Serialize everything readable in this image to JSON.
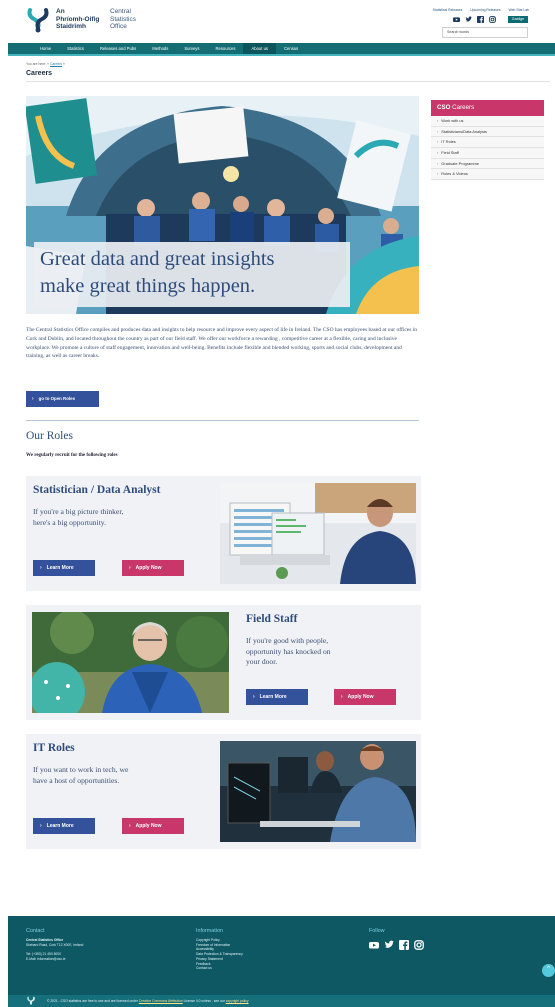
{
  "header": {
    "brand_irish": [
      "An",
      "Phríomh-Oifig",
      "Staidrimh"
    ],
    "brand_english": [
      "Central",
      "Statistics",
      "Office"
    ],
    "top_links": [
      "Statistical Releases",
      "Upcoming Releases",
      "Web Stat Lab"
    ],
    "social_icons": [
      "youtube-icon",
      "twitter-icon",
      "facebook-icon",
      "instagram-icon"
    ],
    "gaeilge_label": "Gaeilge",
    "search_placeholder": "Search words"
  },
  "nav": {
    "items": [
      "Home",
      "Statistics",
      "Releases and Pubs",
      "Methods",
      "Surveys",
      "Resources",
      "About us",
      "Census"
    ],
    "active": "About us"
  },
  "breadcrumb": {
    "prefix": "You are here: »",
    "link": "Careers",
    "suffix": "»"
  },
  "page_title": "Careers",
  "hero": {
    "line1": "Great data and great insights",
    "line2": "make great things happen."
  },
  "intro_text": "The Central Statistics Office compiles and produces data and insights to help resource and improve every aspect of life in Ireland. The CSO has employees based at our offices in Cork and Dublin, and located throughout the country as part of our field staff. We offer our workforce a rewarding , competitive career at a flexible, caring and inclusive workplace. We promote a culture of staff engagement, innovation and well-being. Benefits include flexible and blended working, sports and social clubs, development and training, as well as career breaks.",
  "open_roles_button": "go to Open Roles",
  "roles_heading": "Our Roles",
  "roles_subheading": "We regularly recruit for the following roles",
  "sidebar": {
    "title_bold": "CSO",
    "title_rest": "Careers",
    "items": [
      "Work with us",
      "Statisticians/Data Analysts",
      "IT Roles",
      "Field Staff",
      "Graduate Programme",
      "Roles & Videos"
    ]
  },
  "cards": [
    {
      "title": "Statistician / Data Analyst",
      "subtitle": [
        "If you're a big picture thinker,",
        "here's a big opportunity."
      ],
      "learn_more": "Learn More",
      "apply_now": "Apply Now"
    },
    {
      "title": "Field Staff",
      "subtitle": [
        "If you're good with people,",
        "opportunity has knocked on",
        "your door."
      ],
      "learn_more": "Learn More",
      "apply_now": "Apply Now"
    },
    {
      "title": "IT Roles",
      "subtitle": [
        "If you want to work in tech, we",
        "have a host of opportunities."
      ],
      "learn_more": "Learn More",
      "apply_now": "Apply Now"
    }
  ],
  "footer": {
    "contact_heading": "Contact",
    "contact_lines": [
      "Central Statistics Office",
      "Skehard Road, Cork T12 X00E, Ireland",
      "",
      "Tel:      (+353) 21 453 5000",
      "E-Mail:  information@cso.ie"
    ],
    "info_heading": "Information",
    "info_links": [
      "Copyright Policy",
      "Freedom of Information",
      "Accessibility",
      "Data Protection & Transparency",
      "Privacy Statement",
      "Feedback",
      "Contact us"
    ],
    "follow_heading": "Follow",
    "copyright_prefix": "© 2021 - CSO statistics are free to use and are licensed under",
    "copyright_link": "Creative Commons Attribution",
    "copyright_mid": "License 4.0 unless - see our",
    "copyright_link2": "copyright policy"
  },
  "colors": {
    "teal": "#156d74",
    "navy": "#34529b",
    "pink": "#c9366a",
    "footer": "#0e5864"
  }
}
